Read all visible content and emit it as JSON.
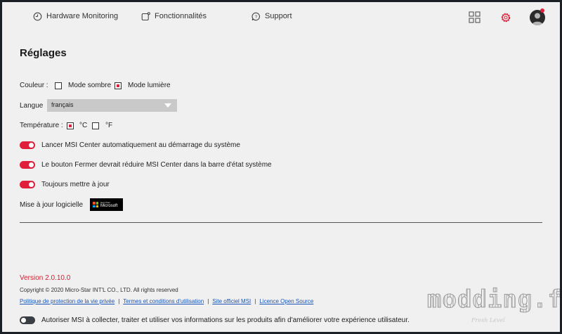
{
  "nav": {
    "hardware_label": "Hardware Monitoring",
    "features_label": "Fonctionnalités",
    "support_label": "Support"
  },
  "page_title": "Réglages",
  "color_setting": {
    "label": "Couleur :",
    "dark_label": "Mode sombre",
    "dark_checked": false,
    "light_label": "Mode lumière",
    "light_checked": true
  },
  "language": {
    "label": "Langue",
    "selected": "français"
  },
  "temperature": {
    "label": "Température :",
    "celsius_label": "°C",
    "celsius_checked": true,
    "fahrenheit_label": "°F",
    "fahrenheit_checked": false
  },
  "toggles": [
    {
      "label": "Lancer MSI Center automatiquement au démarrage du système",
      "on": true
    },
    {
      "label": "Le bouton Fermer devrait réduire MSI Center dans la barre d'état système",
      "on": true
    },
    {
      "label": "Toujours mettre à jour",
      "on": true
    }
  ],
  "software_update": {
    "label": "Mise à jour logicielle",
    "badge_small": "Get it from",
    "badge_big": "Microsoft"
  },
  "footer": {
    "version": "Version 2.0.10.0",
    "copyright": "Copyright © 2020 Micro-Star INT'L CO., LTD. All rights reserved",
    "links": [
      "Politique de protection de la vie privée",
      "Termes et conditions d'utilisation",
      "Site officiel MSI",
      "Licence Open Source"
    ],
    "separator": "|",
    "consent_label": "Autoriser MSI à collecter, traiter et utiliser vos informations sur les produits afin d'améliorer votre expérience utilisateur.",
    "consent_on": false
  },
  "watermark": {
    "text": "modding.fr",
    "sub": "Fresh Level"
  },
  "colors": {
    "accent": "#e0203a",
    "background": "#f0f0f0",
    "link": "#1a55b5"
  },
  "icons": {
    "hardware": "gauge-icon",
    "features": "features-icon",
    "support": "chat-icon",
    "grid": "grid-icon",
    "settings": "gear-icon"
  }
}
